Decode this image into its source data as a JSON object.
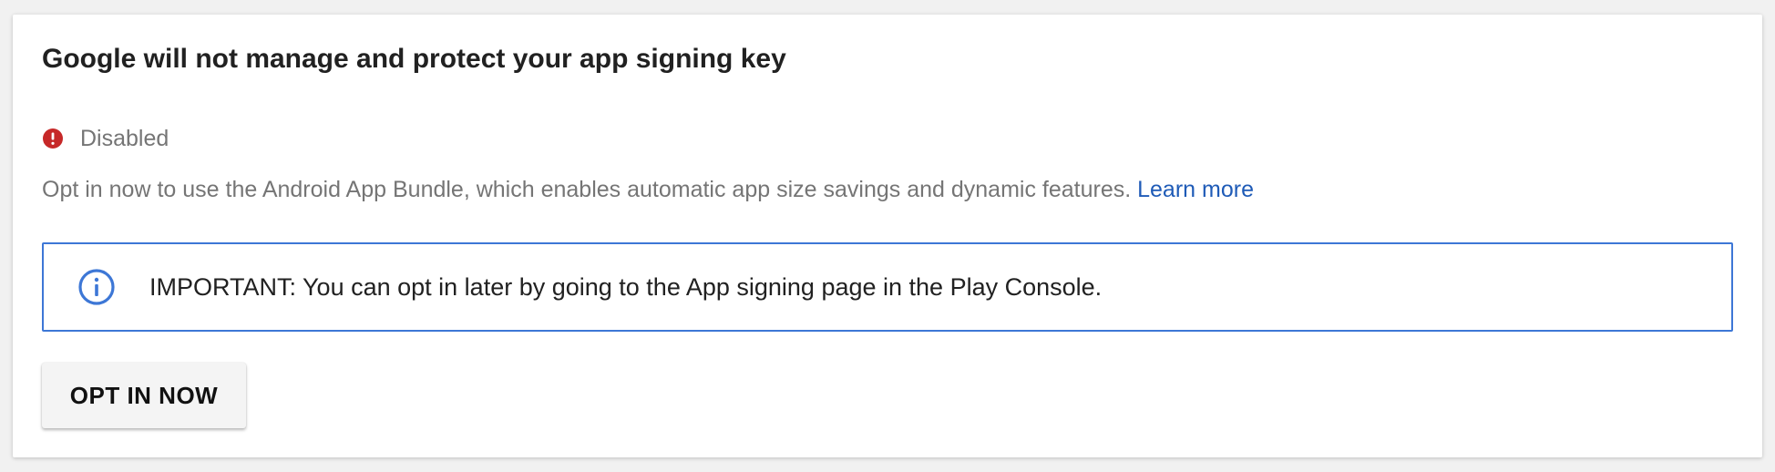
{
  "card": {
    "title": "Google will not manage and protect your app signing key",
    "status": {
      "icon": "error-icon",
      "icon_color": "#c62828",
      "label": "Disabled"
    },
    "description": {
      "text": "Opt in now to use the Android App Bundle, which enables automatic app size savings and dynamic features. ",
      "link_label": "Learn more",
      "link_color": "#1f5bb7"
    },
    "notice": {
      "icon": "info-icon",
      "accent_color": "#3d77d6",
      "text": "IMPORTANT: You can opt in later by going to the App signing page in the Play Console."
    },
    "primary_button": {
      "label": "OPT IN NOW"
    }
  }
}
